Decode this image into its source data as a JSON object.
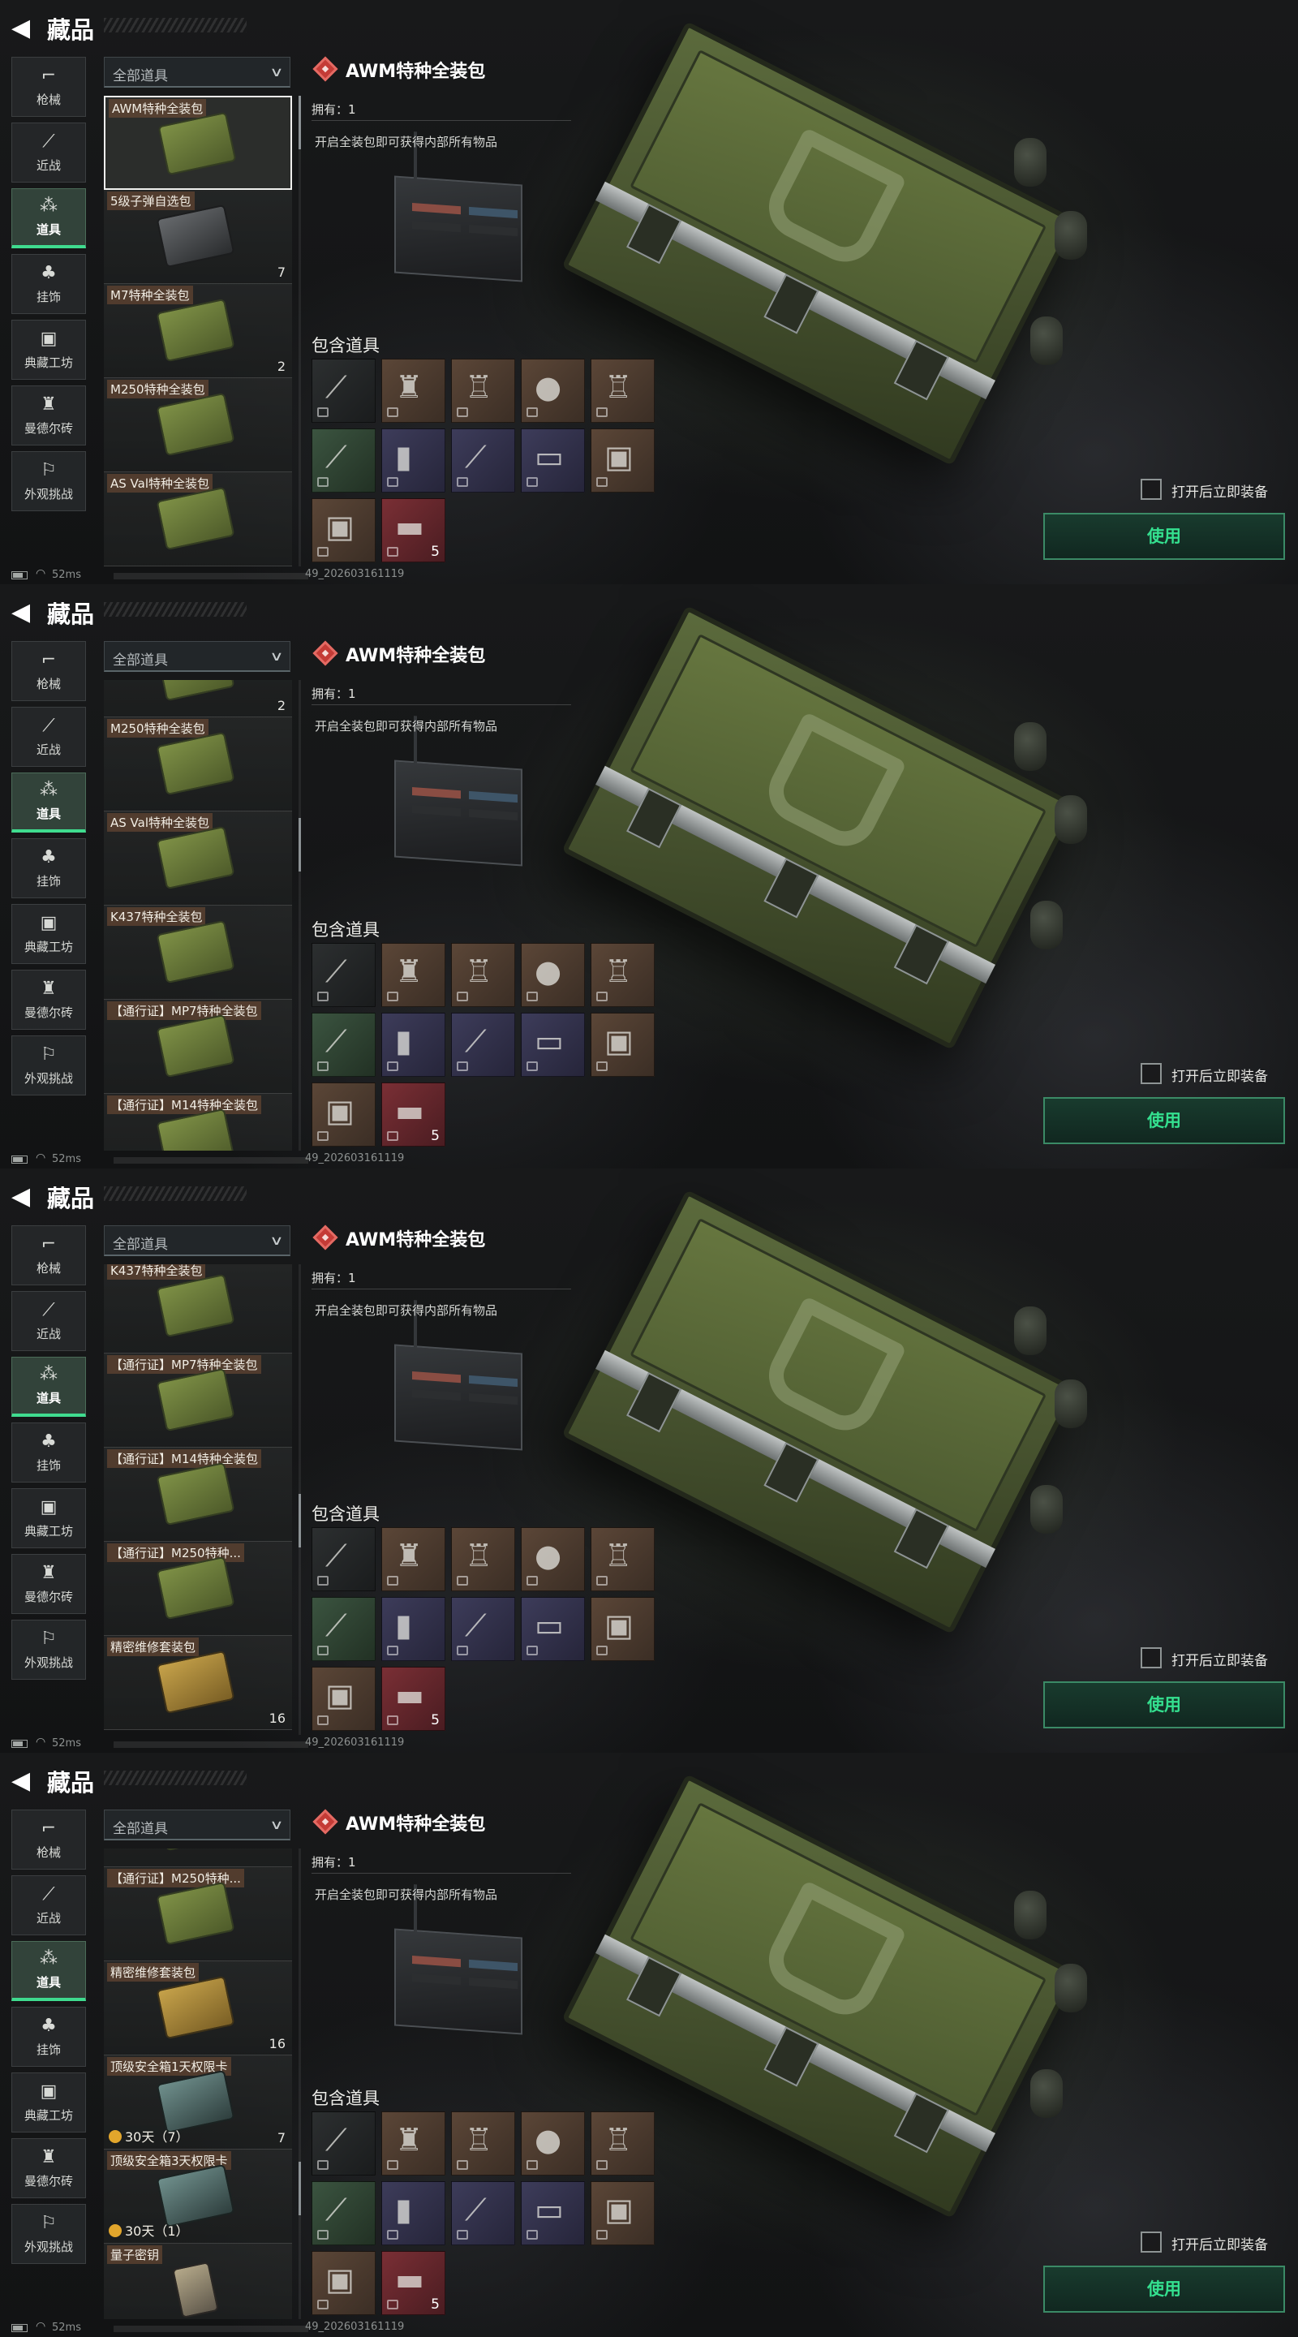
{
  "page_title": "藏品",
  "nav": [
    {
      "label": "枪械",
      "icon": "gun-icon",
      "active": false
    },
    {
      "label": "近战",
      "icon": "knife-icon",
      "active": false
    },
    {
      "label": "道具",
      "icon": "items-icon",
      "active": true
    },
    {
      "label": "挂饰",
      "icon": "charm-icon",
      "active": false
    },
    {
      "label": "典藏工坊",
      "icon": "workshop-icon",
      "active": false
    },
    {
      "label": "曼德尔砖",
      "icon": "brick-icon",
      "active": false
    },
    {
      "label": "外观挑战",
      "icon": "challenge-icon",
      "active": false
    }
  ],
  "filter": {
    "label": "全部道具"
  },
  "frames": [
    {
      "items": [
        {
          "name": "AWM特种全装包",
          "thumb": "green",
          "count": "",
          "timer": "",
          "selected": true,
          "offset": 0
        },
        {
          "name": "5级子弹自选包",
          "thumb": "dark",
          "count": "7",
          "timer": "",
          "selected": false,
          "offset": 1
        },
        {
          "name": "M7特种全装包",
          "thumb": "green",
          "count": "2",
          "timer": "",
          "selected": false,
          "offset": 2
        },
        {
          "name": "M250特种全装包",
          "thumb": "green",
          "count": "",
          "timer": "",
          "selected": false,
          "offset": 3
        },
        {
          "name": "AS Val特种全装包",
          "thumb": "green",
          "count": "",
          "timer": "",
          "selected": false,
          "offset": 4
        }
      ],
      "scroll_fraction": 0.0
    },
    {
      "items": [
        {
          "name": "",
          "thumb": "green",
          "count": "2",
          "timer": "",
          "selected": false,
          "offset": -0.6
        },
        {
          "name": "M250特种全装包",
          "thumb": "green",
          "count": "",
          "timer": "",
          "selected": false,
          "offset": 0.4
        },
        {
          "name": "AS Val特种全装包",
          "thumb": "green",
          "count": "",
          "timer": "",
          "selected": false,
          "offset": 1.4
        },
        {
          "name": "K437特种全装包",
          "thumb": "green",
          "count": "",
          "timer": "",
          "selected": false,
          "offset": 2.4
        },
        {
          "name": "【通行证】MP7特种全装包",
          "thumb": "green",
          "count": "",
          "timer": "",
          "selected": false,
          "offset": 3.4
        },
        {
          "name": "【通行证】M14特种全装包",
          "thumb": "green",
          "count": "",
          "timer": "",
          "selected": false,
          "offset": 4.4
        }
      ],
      "scroll_fraction": 0.33
    },
    {
      "items": [
        {
          "name": "K437特种全装包",
          "thumb": "green",
          "count": "",
          "timer": "",
          "selected": false,
          "offset": -0.05
        },
        {
          "name": "【通行证】MP7特种全装包",
          "thumb": "green",
          "count": "",
          "timer": "",
          "selected": false,
          "offset": 0.95
        },
        {
          "name": "【通行证】M14特种全装包",
          "thumb": "green",
          "count": "",
          "timer": "",
          "selected": false,
          "offset": 1.95
        },
        {
          "name": "【通行证】M250特种...",
          "thumb": "green",
          "count": "",
          "timer": "",
          "selected": false,
          "offset": 2.95
        },
        {
          "name": "精密维修套装包",
          "thumb": "gold",
          "count": "16",
          "timer": "",
          "selected": false,
          "offset": 3.95
        }
      ],
      "scroll_fraction": 0.55
    },
    {
      "items": [
        {
          "name": "",
          "thumb": "green",
          "count": "",
          "timer": "",
          "selected": false,
          "offset": -0.8
        },
        {
          "name": "【通行证】M250特种...",
          "thumb": "green",
          "count": "",
          "timer": "",
          "selected": false,
          "offset": 0.2
        },
        {
          "name": "精密维修套装包",
          "thumb": "gold",
          "count": "16",
          "timer": "",
          "selected": false,
          "offset": 1.2
        },
        {
          "name": "顶级安全箱1天权限卡",
          "thumb": "teal",
          "count": "7",
          "timer": "30天（7）",
          "selected": false,
          "offset": 2.2
        },
        {
          "name": "顶级安全箱3天权限卡",
          "thumb": "teal",
          "count": "",
          "timer": "30天（1）",
          "selected": false,
          "offset": 3.2
        },
        {
          "name": "量子密钥",
          "thumb": "key",
          "count": "",
          "timer": "",
          "selected": false,
          "offset": 4.2
        }
      ],
      "scroll_fraction": 0.75
    }
  ],
  "detail": {
    "title": "AWM特种全装包",
    "owned": "拥有：1",
    "description": "开启全装包即可获得内部所有物品",
    "contains_label": "包含道具",
    "contents": [
      {
        "icon": "rifle-icon",
        "color": "dark",
        "count": ""
      },
      {
        "icon": "backpack-icon",
        "color": "brown",
        "count": ""
      },
      {
        "icon": "vest-icon",
        "color": "brown",
        "count": ""
      },
      {
        "icon": "helmet-icon",
        "color": "brown",
        "count": ""
      },
      {
        "icon": "armor-icon",
        "color": "brown",
        "count": ""
      },
      {
        "icon": "syringe-icon",
        "color": "green",
        "count": ""
      },
      {
        "icon": "ammo-icon",
        "color": "purple",
        "count": ""
      },
      {
        "icon": "bandage-icon",
        "color": "purple",
        "count": ""
      },
      {
        "icon": "chip-icon",
        "color": "purple",
        "count": ""
      },
      {
        "icon": "battery-icon",
        "color": "brown",
        "count": ""
      },
      {
        "icon": "medkit-icon",
        "color": "brown",
        "count": ""
      },
      {
        "icon": "case-icon",
        "color": "red",
        "count": "5"
      }
    ],
    "equip_label": "打开后立即装备",
    "use_button": "使用"
  },
  "status": {
    "ping": "52ms",
    "build": "49_202603161119"
  },
  "colors": {
    "accent": "#34e08f",
    "nav_active_bar": "#3fdc8f",
    "detail_icon": "#c43b36"
  }
}
